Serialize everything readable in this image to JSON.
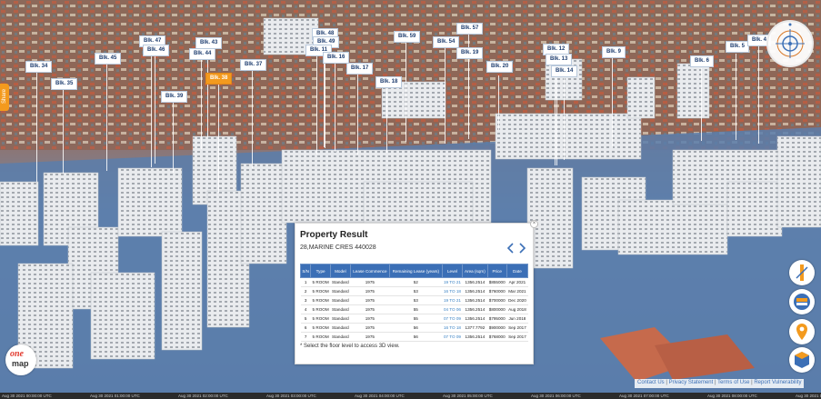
{
  "scene": {
    "labels": [
      {
        "text": "Blk. 34",
        "selected": false
      },
      {
        "text": "Blk. 35",
        "selected": false
      },
      {
        "text": "Blk. 45",
        "selected": false
      },
      {
        "text": "Blk. 47",
        "selected": false
      },
      {
        "text": "Blk. 46",
        "selected": false
      },
      {
        "text": "Blk. 43",
        "selected": false
      },
      {
        "text": "Blk. 44",
        "selected": false
      },
      {
        "text": "Blk. 38",
        "selected": true
      },
      {
        "text": "Blk. 39",
        "selected": false
      },
      {
        "text": "Blk. 37",
        "selected": false
      },
      {
        "text": "Blk. 48",
        "selected": false
      },
      {
        "text": "Blk. 49",
        "selected": false
      },
      {
        "text": "Blk. 11",
        "selected": false
      },
      {
        "text": "Blk. 16",
        "selected": false
      },
      {
        "text": "Blk. 17",
        "selected": false
      },
      {
        "text": "Blk. 59",
        "selected": false
      },
      {
        "text": "Blk. 18",
        "selected": false
      },
      {
        "text": "Blk. 54",
        "selected": false
      },
      {
        "text": "Blk. 57",
        "selected": false
      },
      {
        "text": "Blk. 19",
        "selected": false
      },
      {
        "text": "Blk. 20",
        "selected": false
      },
      {
        "text": "Blk. 12",
        "selected": false
      },
      {
        "text": "Blk. 13",
        "selected": false
      },
      {
        "text": "Blk. 14",
        "selected": false
      },
      {
        "text": "Blk. 9",
        "selected": false
      },
      {
        "text": "Blk. 6",
        "selected": false
      },
      {
        "text": "Blk. 5",
        "selected": false
      },
      {
        "text": "Blk. 4",
        "selected": false
      }
    ]
  },
  "share_tab": {
    "label": "Share"
  },
  "logo": {
    "line1": "one",
    "line2": "map"
  },
  "panel": {
    "title": "Property Result",
    "address": "28,MARINE CRES 440028",
    "note": "* Select the floor level to access 3D view.",
    "close_glyph": "×",
    "columns": [
      "S/N",
      "Type",
      "Model",
      "Lease Commence",
      "Remaining Lease (years)",
      "Level",
      "Area (sqm)",
      "Price",
      "Date"
    ],
    "rows": [
      [
        "1",
        "5 ROOM",
        "Standard",
        "1975",
        "52",
        "19 TO 21",
        "1356.2514",
        "$855000",
        "Apr 2021"
      ],
      [
        "2",
        "5 ROOM",
        "Standard",
        "1975",
        "53",
        "16 TO 18",
        "1356.2514",
        "$760000",
        "Mar 2021"
      ],
      [
        "3",
        "5 ROOM",
        "Standard",
        "1975",
        "53",
        "19 TO 21",
        "1356.2514",
        "$700000",
        "Dec 2020"
      ],
      [
        "4",
        "5 ROOM",
        "Standard",
        "1975",
        "55",
        "04 TO 06",
        "1356.2514",
        "$800000",
        "Aug 2018"
      ],
      [
        "5",
        "5 ROOM",
        "Standard",
        "1975",
        "55",
        "07 TO 09",
        "1356.2514",
        "$795000",
        "Jun 2018"
      ],
      [
        "6",
        "5 ROOM",
        "Standard",
        "1975",
        "56",
        "16 TO 18",
        "1377.7792",
        "$900000",
        "Sep 2017"
      ],
      [
        "7",
        "5 ROOM",
        "Standard",
        "1975",
        "56",
        "07 TO 09",
        "1356.2514",
        "$768000",
        "Sep 2017"
      ]
    ]
  },
  "footer": {
    "links": [
      "Contact Us",
      "Privacy Statement",
      "Terms of Use",
      "Report Vulnerability"
    ],
    "separator": "|"
  },
  "timeline": {
    "ticks": [
      "Aug 30 2021 00:00:00 UTC",
      "Aug 30 2021 01:00:00 UTC",
      "Aug 30 2021 02:00:00 UTC",
      "Aug 30 2021 03:00:00 UTC",
      "Aug 30 2021 04:00:00 UTC",
      "Aug 30 2021 05:00:00 UTC",
      "Aug 30 2021 06:00:00 UTC",
      "Aug 30 2021 07:00:00 UTC",
      "Aug 30 2021 08:00:00 UTC",
      "Aug 30 2021 09:00:00 UTC"
    ]
  },
  "colors": {
    "accent_orange": "#f39a1e",
    "table_header_blue": "#3b6fb6",
    "link_blue": "#3b82c4"
  },
  "icons": [
    "compass-icon",
    "measure-icon",
    "layers-icon",
    "location-pin-icon",
    "3d-building-icon",
    "close-icon",
    "chevron-left-icon",
    "chevron-right-icon"
  ]
}
